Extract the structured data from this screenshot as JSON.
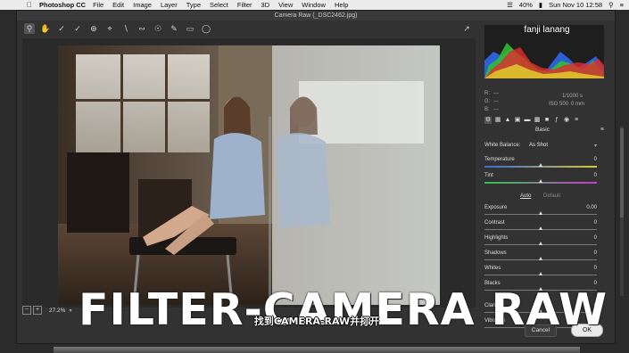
{
  "menubar": {
    "app": "Photoshop CC",
    "menus": [
      "File",
      "Edit",
      "Image",
      "Layer",
      "Type",
      "Select",
      "Filter",
      "3D",
      "View",
      "Window",
      "Help"
    ],
    "battery": "40%",
    "datetime": "Sun Nov 10  12:58"
  },
  "window": {
    "title": "Camera Raw (_DSC2462.jpg)"
  },
  "toolbar": {
    "tools": [
      "zoom-icon",
      "hand-icon",
      "white-balance-icon",
      "color-sampler-icon",
      "targeted-adjust-icon",
      "crop-icon",
      "straighten-icon",
      "spot-removal-icon",
      "red-eye-icon",
      "adjustment-brush-icon",
      "graduated-filter-icon",
      "radial-filter-icon"
    ]
  },
  "histogram": {
    "overlay_text": "fanji lanang"
  },
  "readout": {
    "r": "R:",
    "g": "G:",
    "b": "B:",
    "r_val": "---",
    "g_val": "---",
    "b_val": "---",
    "shutter": "1/1000 s",
    "iso": "ISO 500",
    "focal": "0 mm"
  },
  "panel": {
    "title": "Basic",
    "white_balance_label": "White Balance:",
    "white_balance_value": "As Shot",
    "auto": "Auto",
    "default": "Default",
    "sliders": [
      {
        "name": "Temperature",
        "value": "0",
        "level": 0.5
      },
      {
        "name": "Tint",
        "value": "0",
        "level": 0.5
      },
      {
        "name": "Exposure",
        "value": "0.00",
        "level": 0.5
      },
      {
        "name": "Contrast",
        "value": "0",
        "level": 0.5
      },
      {
        "name": "Highlights",
        "value": "0",
        "level": 0.5
      },
      {
        "name": "Shadows",
        "value": "0",
        "level": 0.5
      },
      {
        "name": "Whites",
        "value": "0",
        "level": 0.5
      },
      {
        "name": "Blacks",
        "value": "0",
        "level": 0.5
      },
      {
        "name": "Clarity",
        "value": "0",
        "level": 0.5
      },
      {
        "name": "Vibrance",
        "value": "0",
        "level": 0.5
      }
    ]
  },
  "zoom": {
    "value": "27.2%"
  },
  "buttons": {
    "cancel": "Cancel",
    "ok": "OK"
  },
  "overlay": {
    "title": "FILTER-CAMERA RAW",
    "subtitle": "找到CAMERA-RAW并打开"
  },
  "colors": {
    "accent": "#3a7bd5",
    "panel_bg": "#323232",
    "canvas_bg": "#2a2a2a"
  }
}
